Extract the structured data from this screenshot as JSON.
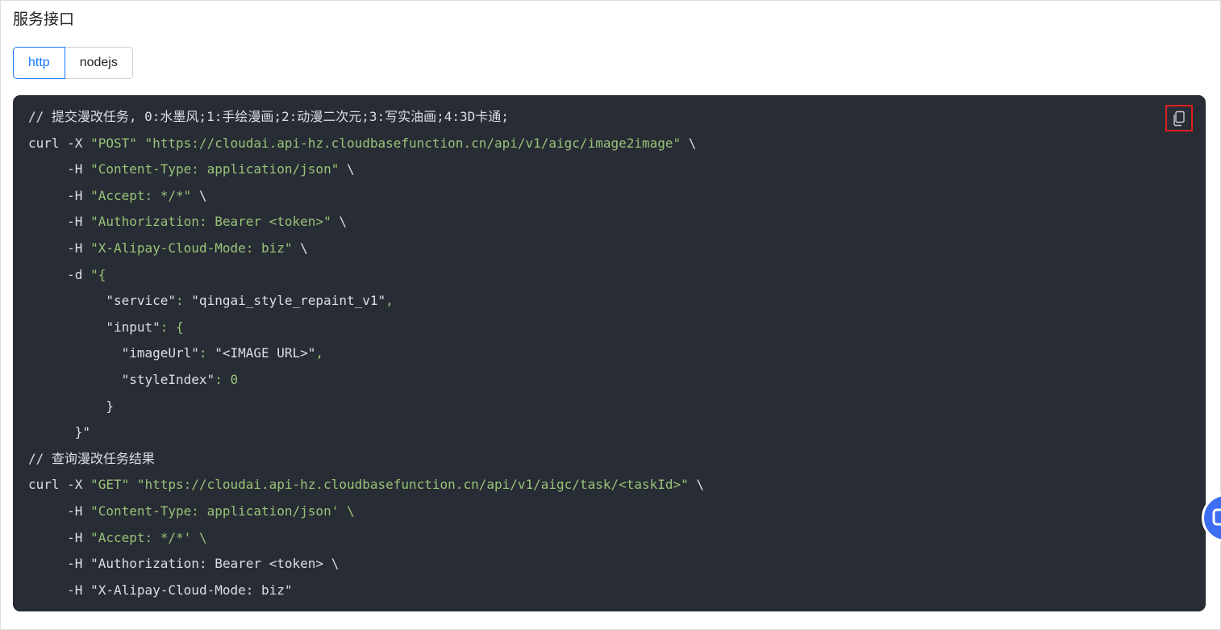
{
  "section_title": "服务接口",
  "tabs": [
    "http",
    "nodejs"
  ],
  "active_tab": "http",
  "code_lines": [
    {
      "indent": "",
      "parts": [
        {
          "t": "// 提交漫改任务, 0:水墨风;1:手绘漫画;2:动漫二次元;3:写实油画;4:3D卡通;",
          "c": "c"
        }
      ]
    },
    {
      "indent": "",
      "parts": [
        {
          "t": "curl -X ",
          "c": "c"
        },
        {
          "t": "\"POST\" \"https://cloudai.api-hz.cloudbasefunction.cn/api/v1/aigc/image2image\"",
          "c": "s"
        },
        {
          "t": " \\",
          "c": "c"
        }
      ]
    },
    {
      "indent": "     ",
      "parts": [
        {
          "t": "-H ",
          "c": "c"
        },
        {
          "t": "\"Content-Type: application/json\"",
          "c": "s"
        },
        {
          "t": " \\",
          "c": "c"
        }
      ]
    },
    {
      "indent": "     ",
      "parts": [
        {
          "t": "-H ",
          "c": "c"
        },
        {
          "t": "\"Accept: */*\"",
          "c": "s"
        },
        {
          "t": " \\",
          "c": "c"
        }
      ]
    },
    {
      "indent": "     ",
      "parts": [
        {
          "t": "-H ",
          "c": "c"
        },
        {
          "t": "\"Authorization: Bearer <token>\"",
          "c": "s"
        },
        {
          "t": " \\",
          "c": "c"
        }
      ]
    },
    {
      "indent": "     ",
      "parts": [
        {
          "t": "-H ",
          "c": "c"
        },
        {
          "t": "\"X-Alipay-Cloud-Mode: biz\"",
          "c": "s"
        },
        {
          "t": " \\",
          "c": "c"
        }
      ]
    },
    {
      "indent": "     ",
      "parts": [
        {
          "t": "-d ",
          "c": "c"
        },
        {
          "t": "\"{",
          "c": "s"
        }
      ]
    },
    {
      "indent": "          ",
      "parts": [
        {
          "t": "\"service\"",
          "c": "c"
        },
        {
          "t": ": ",
          "c": "s"
        },
        {
          "t": "\"qingai_style_repaint_v1\"",
          "c": "c"
        },
        {
          "t": ",",
          "c": "s"
        }
      ]
    },
    {
      "indent": "          ",
      "parts": [
        {
          "t": "\"input\"",
          "c": "c"
        },
        {
          "t": ": {",
          "c": "s"
        }
      ]
    },
    {
      "indent": "            ",
      "parts": [
        {
          "t": "\"imageUrl\"",
          "c": "c"
        },
        {
          "t": ": ",
          "c": "s"
        },
        {
          "t": "\"<IMAGE URL>\"",
          "c": "c"
        },
        {
          "t": ",",
          "c": "s"
        }
      ]
    },
    {
      "indent": "            ",
      "parts": [
        {
          "t": "\"styleIndex\"",
          "c": "c"
        },
        {
          "t": ": 0",
          "c": "s"
        }
      ]
    },
    {
      "indent": "          ",
      "parts": [
        {
          "t": "}",
          "c": "c"
        }
      ]
    },
    {
      "indent": "      ",
      "parts": [
        {
          "t": "}\"",
          "c": "c"
        }
      ]
    },
    {
      "indent": "",
      "parts": [
        {
          "t": "// 查询漫改任务结果",
          "c": "c"
        }
      ]
    },
    {
      "indent": "",
      "parts": [
        {
          "t": "curl -X ",
          "c": "c"
        },
        {
          "t": "\"GET\" \"https://cloudai.api-hz.cloudbasefunction.cn/api/v1/aigc/task/<taskId>\"",
          "c": "s"
        },
        {
          "t": " \\",
          "c": "c"
        }
      ]
    },
    {
      "indent": "     ",
      "parts": [
        {
          "t": "-H ",
          "c": "c"
        },
        {
          "t": "\"Content-Type: application/json' \\",
          "c": "s"
        }
      ]
    },
    {
      "indent": "     ",
      "parts": [
        {
          "t": "-H ",
          "c": "c"
        },
        {
          "t": "\"Accept: */*' \\",
          "c": "s"
        }
      ]
    },
    {
      "indent": "     ",
      "parts": [
        {
          "t": "-H ",
          "c": "c"
        },
        {
          "t": "\"Authorization: Bearer <token> \\",
          "c": "c"
        }
      ]
    },
    {
      "indent": "     ",
      "parts": [
        {
          "t": "-H ",
          "c": "c"
        },
        {
          "t": "\"X-Alipay-Cloud-Mode: biz\"",
          "c": "c"
        }
      ]
    }
  ],
  "icons": {
    "copy": "copy-icon",
    "float": "floating-action-icon"
  },
  "colors": {
    "accent": "#1677ff",
    "code_bg": "#282c34",
    "string": "#98c379",
    "highlight_border": "#e02020"
  }
}
